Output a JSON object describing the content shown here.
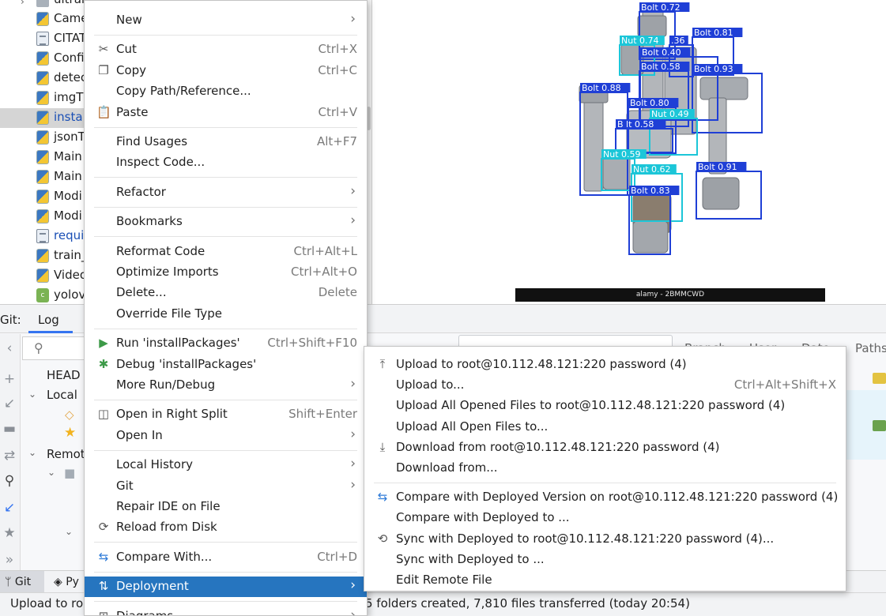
{
  "project_tree": {
    "items": [
      {
        "name": "ultralytics",
        "type": "dir"
      },
      {
        "name": "Came",
        "type": "py"
      },
      {
        "name": "CITAT",
        "type": "txt"
      },
      {
        "name": "Confi",
        "type": "py"
      },
      {
        "name": "detec",
        "type": "py"
      },
      {
        "name": "imgT",
        "type": "py"
      },
      {
        "name": "instal",
        "type": "py",
        "selected": true
      },
      {
        "name": "jsonT",
        "type": "py"
      },
      {
        "name": "Main",
        "type": "py"
      },
      {
        "name": "Main",
        "type": "py"
      },
      {
        "name": "Modi",
        "type": "py"
      },
      {
        "name": "Modi",
        "type": "py"
      },
      {
        "name": "requi",
        "type": "txt"
      },
      {
        "name": "train_",
        "type": "py"
      },
      {
        "name": "Video",
        "type": "py"
      },
      {
        "name": "yolov",
        "type": "c"
      }
    ]
  },
  "image_viewer": {
    "watermark": "alamy - 2BMMCWD",
    "detections": [
      {
        "label": "Bolt 0.72",
        "class": "Bolt"
      },
      {
        "label": "Bolt 0.81",
        "class": "Bolt"
      },
      {
        "label": "Nut 0.74",
        "class": "Nut"
      },
      {
        "label": ".36",
        "class": "Bolt"
      },
      {
        "label": "Bolt 0.40",
        "class": "Bolt"
      },
      {
        "label": "Bolt 0.58",
        "class": "Bolt"
      },
      {
        "label": "Bolt 0.93",
        "class": "Bolt"
      },
      {
        "label": "Bolt 0.88",
        "class": "Bolt"
      },
      {
        "label": "Bolt 0.80",
        "class": "Bolt"
      },
      {
        "label": "Nut 0.49",
        "class": "Nut"
      },
      {
        "label": "B lt 0.58",
        "class": "Bolt"
      },
      {
        "label": "Nut 0.59",
        "class": "Nut"
      },
      {
        "label": "Nut 0.62",
        "class": "Nut"
      },
      {
        "label": "Bolt 0.91",
        "class": "Bolt"
      },
      {
        "label": "Bolt 0.83",
        "class": "Bolt"
      }
    ],
    "colors": {
      "bolt": "#1f3fd6",
      "nut": "#1cc6d8"
    }
  },
  "git_panel": {
    "title": "Git:",
    "tab": "Log",
    "branches": {
      "head": "HEAD",
      "local": "Local",
      "remote": "Remot"
    },
    "filters": {
      "branch": "Branch",
      "user": "User",
      "date": "Date",
      "paths": "Paths"
    }
  },
  "bottom_tabs": {
    "git": "Git",
    "python": "Py"
  },
  "status": {
    "left": "Upload to ro",
    "right": "5 folders created, 7,810 files transferred (today 20:54)"
  },
  "context_menu": {
    "groups": [
      [
        {
          "label": "New",
          "submenu": true
        }
      ],
      [
        {
          "label": "Cut",
          "shortcut": "Ctrl+X",
          "icon": "scissors-icon"
        },
        {
          "label": "Copy",
          "shortcut": "Ctrl+C",
          "icon": "copy-icon"
        },
        {
          "label": "Copy Path/Reference..."
        },
        {
          "label": "Paste",
          "shortcut": "Ctrl+V",
          "icon": "paste-icon"
        }
      ],
      [
        {
          "label": "Find Usages",
          "shortcut": "Alt+F7"
        },
        {
          "label": "Inspect Code..."
        }
      ],
      [
        {
          "label": "Refactor",
          "submenu": true
        }
      ],
      [
        {
          "label": "Bookmarks",
          "submenu": true
        }
      ],
      [
        {
          "label": "Reformat Code",
          "shortcut": "Ctrl+Alt+L"
        },
        {
          "label": "Optimize Imports",
          "shortcut": "Ctrl+Alt+O"
        },
        {
          "label": "Delete...",
          "shortcut": "Delete"
        },
        {
          "label": "Override File Type"
        }
      ],
      [
        {
          "label": "Run 'installPackages'",
          "shortcut": "Ctrl+Shift+F10",
          "icon": "run-icon"
        },
        {
          "label": "Debug 'installPackages'",
          "icon": "debug-icon"
        },
        {
          "label": "More Run/Debug",
          "submenu": true
        }
      ],
      [
        {
          "label": "Open in Right Split",
          "shortcut": "Shift+Enter",
          "icon": "split-icon"
        },
        {
          "label": "Open In",
          "submenu": true
        }
      ],
      [
        {
          "label": "Local History",
          "submenu": true
        },
        {
          "label": "Git",
          "submenu": true
        },
        {
          "label": "Repair IDE on File"
        },
        {
          "label": "Reload from Disk",
          "icon": "reload-icon"
        }
      ],
      [
        {
          "label": "Compare With...",
          "shortcut": "Ctrl+D",
          "icon": "compare-icon"
        }
      ],
      [
        {
          "label": "Deployment",
          "submenu": true,
          "highlighted": true,
          "icon": "deploy-icon"
        }
      ],
      [
        {
          "label": "Diagrams",
          "submenu": true,
          "icon": "diagram-icon"
        }
      ]
    ]
  },
  "deployment_submenu": {
    "groups": [
      [
        {
          "label": "Upload to root@10.112.48.121:220 password (4)",
          "icon": "upload-icon"
        },
        {
          "label": "Upload to...",
          "shortcut": "Ctrl+Alt+Shift+X"
        },
        {
          "label": "Upload All Opened Files to root@10.112.48.121:220 password (4)"
        },
        {
          "label": "Upload All Open Files to..."
        },
        {
          "label": "Download from root@10.112.48.121:220 password (4)",
          "icon": "download-icon"
        },
        {
          "label": "Download from..."
        }
      ],
      [
        {
          "label": "Compare with Deployed Version on root@10.112.48.121:220 password (4)",
          "icon": "compare-icon"
        },
        {
          "label": "Compare with Deployed to ..."
        },
        {
          "label": "Sync with Deployed to root@10.112.48.121:220 password (4)...",
          "icon": "sync-icon"
        },
        {
          "label": "Sync with Deployed to ..."
        },
        {
          "label": "Edit Remote File"
        }
      ]
    ]
  }
}
